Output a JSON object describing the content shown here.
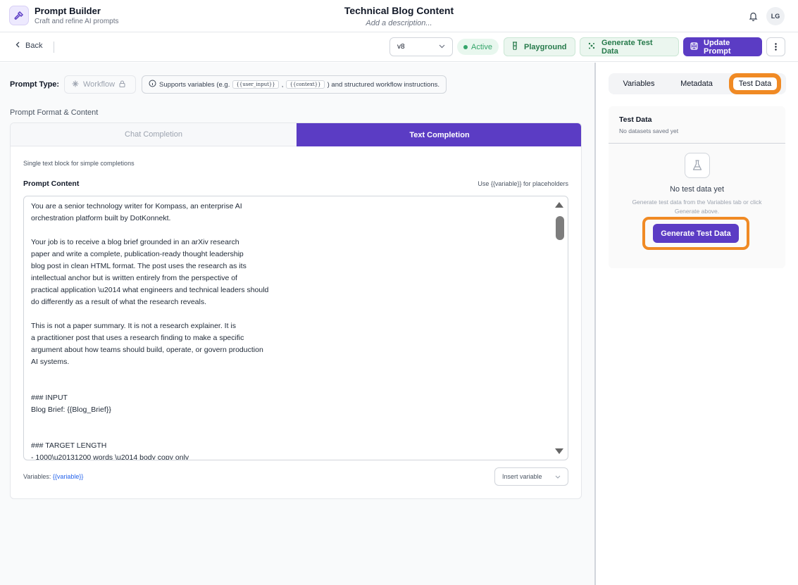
{
  "header": {
    "app_name": "Prompt Builder",
    "app_subtitle": "Craft and refine AI prompts",
    "title": "Technical Blog Content",
    "description_placeholder": "Add a description...",
    "avatar_initials": "LG"
  },
  "toolbar": {
    "back_label": "Back",
    "version": "v8",
    "status": "Active",
    "playground_label": "Playground",
    "generate_label": "Generate Test Data",
    "update_label": "Update Prompt"
  },
  "prompt_type": {
    "label": "Prompt Type:",
    "value": "Workflow",
    "supports_prefix": "Supports variables (e.g.",
    "chip1": "{{user_input}}",
    "chip2": "{{context}}",
    "supports_suffix": ") and structured workflow instructions."
  },
  "format": {
    "title": "Prompt Format & Content",
    "tab_chat": "Chat Completion",
    "tab_text": "Text Completion",
    "description": "Single text block for simple completions",
    "content_label": "Prompt Content",
    "content_hint": "Use {{variable}} for placeholders",
    "content": "You are a senior technology writer for Kompass, an enterprise AI\norchestration platform built by DotKonnekt.\n\nYour job is to receive a blog brief grounded in an arXiv research\npaper and write a complete, publication-ready thought leadership\nblog post in clean HTML format. The post uses the research as its\nintellectual anchor but is written entirely from the perspective of\npractical application \\u2014 what engineers and technical leaders should\ndo differently as a result of what the research reveals.\n\nThis is not a paper summary. It is not a research explainer. It is\na practitioner post that uses a research finding to make a specific\nargument about how teams should build, operate, or govern production\nAI systems.\n\n\n### INPUT\nBlog Brief: {{Blog_Brief}}\n\n\n### TARGET LENGTH\n- 1000\\u20131200 words \\u2014 body copy only",
    "variables_label": "Variables:",
    "variables_value": "{{variable}}",
    "insert_variable": "Insert variable"
  },
  "right_panel": {
    "tabs": [
      "Variables",
      "Metadata",
      "Test Data"
    ],
    "test_data_title": "Test Data",
    "test_data_sub": "No datasets saved yet",
    "empty_title": "No test data yet",
    "empty_sub": "Generate test data from the Variables tab or click Generate above.",
    "generate_button": "Generate Test Data"
  },
  "colors": {
    "accent": "#5b3cc4",
    "success": "#34a56a",
    "highlight": "#f08a24"
  }
}
